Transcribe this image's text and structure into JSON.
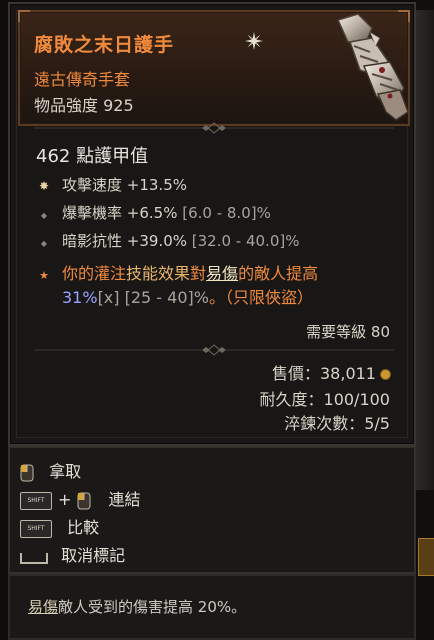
{
  "item": {
    "name": "腐敗之末日護手",
    "type": "遠古傳奇手套",
    "power": "物品強度 925",
    "armor": "462 點護甲值",
    "affixes": [
      {
        "bullet": "✸",
        "bullet_color": "#e8d2a0",
        "text": "攻擊速度 +13.5%",
        "range": ""
      },
      {
        "bullet": "◆",
        "bullet_color": "#8b867d",
        "text": "爆擊機率 +6.5%",
        "range": " [6.0 - 8.0]%"
      },
      {
        "bullet": "◆",
        "bullet_color": "#8b867d",
        "text": "暗影抗性 +39.0%",
        "range": " [32.0 - 40.0]%"
      }
    ],
    "legendary": {
      "bullet": "★",
      "line1_a": "你的灌注",
      "line1_kw": "技能效果",
      "line1_b": "對",
      "line1_vul": "易傷",
      "line1_c": "的敵人提高",
      "line2_num": "31%",
      "line2_scal": "[x]",
      "line2_range": " [25 - 40]%",
      "line2_tail": "。（只限俠盜）"
    },
    "required_level": "需要等級 80",
    "sell_value": "售價：38,011",
    "durability": "耐久度：100/100",
    "temper": "淬鍊次數：5/5"
  },
  "actions": [
    {
      "label": "拿取",
      "keys": [
        "mouse-left"
      ]
    },
    {
      "label": "連結",
      "keys": [
        "SHIFT",
        "+",
        "mouse-left"
      ]
    },
    {
      "label": "比較",
      "keys": [
        "SHIFT"
      ]
    },
    {
      "label": "取消標記",
      "keys": [
        "space"
      ]
    }
  ],
  "shift_label": "SHIFT",
  "plus_label": "+",
  "footer": {
    "vul": "易傷",
    "text": "敵人受到的傷害提高 20%。"
  },
  "colors": {
    "legendary_orange": "#f08a3c",
    "number_blue": "#9aa3ff",
    "gold": "#c9962f"
  }
}
